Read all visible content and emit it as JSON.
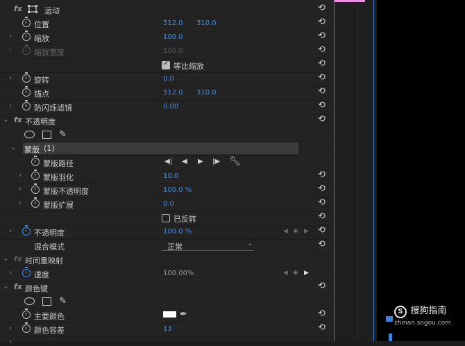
{
  "motion": {
    "header": "运动",
    "position": {
      "label": "位置",
      "x": "512.0",
      "y": "310.0"
    },
    "scale": {
      "label": "缩放",
      "value": "100.0"
    },
    "scale_width": {
      "label": "缩放宽度",
      "value": "100.0"
    },
    "uniform_scale": {
      "label": "等比缩放",
      "checked": true
    },
    "rotation": {
      "label": "旋转",
      "value": "0.0"
    },
    "anchor": {
      "label": "锚点",
      "x": "512.0",
      "y": "310.0"
    },
    "antiflicker": {
      "label": "防闪烁滤镜",
      "value": "0.00"
    }
  },
  "opacity": {
    "header": "不透明度",
    "mask": {
      "header": "蒙版",
      "count": "(1)",
      "path_label": "蒙版路径",
      "feather": {
        "label": "蒙版羽化",
        "value": "10.0"
      },
      "opacity": {
        "label": "蒙版不透明度",
        "value": "100.0 %"
      },
      "expansion": {
        "label": "蒙版扩展",
        "value": "0.0"
      },
      "inverted": {
        "label": "已反转",
        "checked": false
      }
    },
    "opacity_prop": {
      "label": "不透明度",
      "value": "100.0 %"
    },
    "blend": {
      "label": "混合模式",
      "value": "正常"
    }
  },
  "time_remap": {
    "header": "时间重映射",
    "speed": {
      "label": "速度",
      "value": "100.00%"
    }
  },
  "color_key": {
    "header": "颜色键",
    "key_color": {
      "label": "主要颜色",
      "swatch": "#ffffff"
    },
    "tolerance": {
      "label": "颜色容差",
      "value": "13"
    }
  },
  "watermark": {
    "brand": "搜狗指南",
    "url": "zhinan.sogou.com"
  },
  "colors": {
    "value_blue": "#3d8fe6",
    "accent_blue": "#3a8bff",
    "clip_pink": "#e88fe0"
  }
}
